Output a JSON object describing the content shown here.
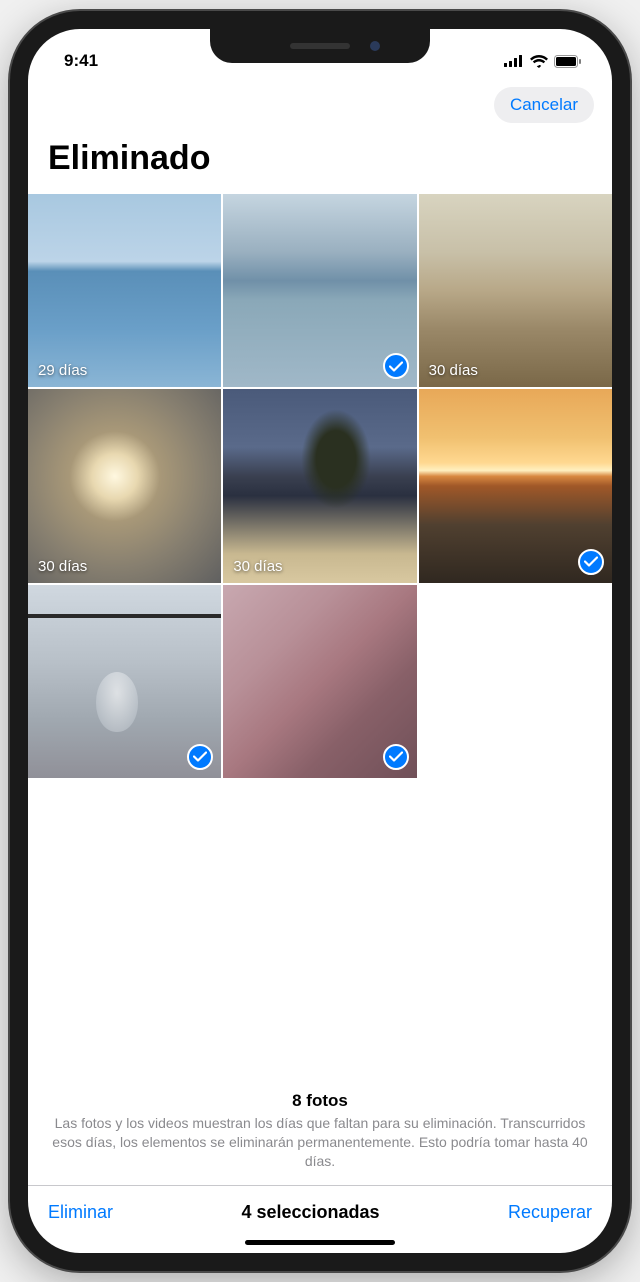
{
  "status": {
    "time": "9:41"
  },
  "nav": {
    "cancel": "Cancelar"
  },
  "title": "Eliminado",
  "photos": [
    {
      "days": "29 días",
      "selected": false,
      "imgClass": "img-1"
    },
    {
      "days": "",
      "selected": true,
      "imgClass": "img-2"
    },
    {
      "days": "30 días",
      "selected": false,
      "imgClass": "img-3"
    },
    {
      "days": "30 días",
      "selected": false,
      "imgClass": "img-4"
    },
    {
      "days": "30 días",
      "selected": false,
      "imgClass": "img-5"
    },
    {
      "days": "",
      "selected": true,
      "imgClass": "img-6"
    },
    {
      "days": "",
      "selected": true,
      "imgClass": "img-7"
    },
    {
      "days": "",
      "selected": true,
      "imgClass": "img-8"
    }
  ],
  "footer": {
    "count": "8 fotos",
    "desc": "Las fotos y los videos muestran los días que faltan para su eliminación. Transcurridos esos días, los elementos se eliminarán permanentemente. Esto podría tomar hasta 40 días."
  },
  "toolbar": {
    "delete": "Eliminar",
    "selectedCount": "4 seleccionadas",
    "recover": "Recuperar"
  }
}
